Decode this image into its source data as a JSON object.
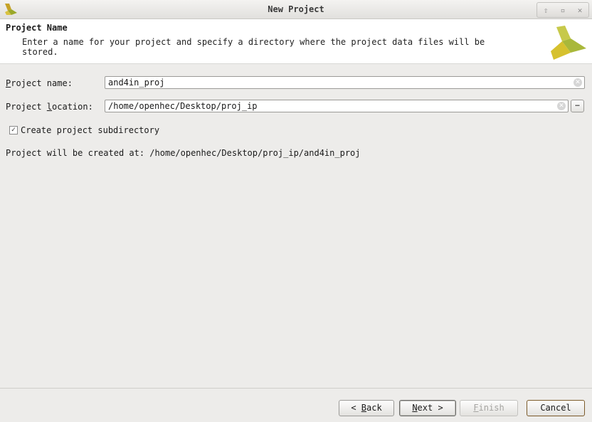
{
  "window": {
    "title": "New Project"
  },
  "header": {
    "title": "Project Name",
    "description": "Enter a name for your project and specify a directory where the project data files will be stored."
  },
  "form": {
    "name_label_u": "P",
    "name_label_rest": "roject name:",
    "name_value": "and4in_proj",
    "location_label_pre": "Project ",
    "location_label_u": "l",
    "location_label_rest": "ocation:",
    "location_value": "/home/openhec/Desktop/proj_ip",
    "browse_label": "…",
    "subdir_label": "Create project subdirectory",
    "subdir_checked": true,
    "created_text": "Project will be created at: /home/openhec/Desktop/proj_ip/and4in_proj"
  },
  "buttons": {
    "back_pre": "< ",
    "back_u": "B",
    "back_rest": "ack",
    "next_u": "N",
    "next_rest": "ext >",
    "finish_u": "F",
    "finish_rest": "inish",
    "cancel": "Cancel"
  }
}
